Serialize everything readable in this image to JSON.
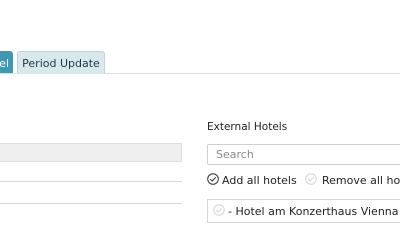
{
  "tabs": [
    {
      "label": "el",
      "active": true
    },
    {
      "label": "Period Update",
      "active": false
    }
  ],
  "external_hotels": {
    "title": "External Hotels",
    "search_placeholder": "Search",
    "add_all_label": "Add all hotels",
    "remove_all_label": "Remove all hote",
    "items": [
      {
        "prefix": "- ",
        "name": "Hotel am Konzerthaus Vienna"
      }
    ]
  },
  "colors": {
    "tab_active_bg": "#3f98b2",
    "tab_inactive_bg": "#d8e9ee"
  },
  "icons": [
    "check-circle-icon",
    "check-circle-icon-faded"
  ]
}
